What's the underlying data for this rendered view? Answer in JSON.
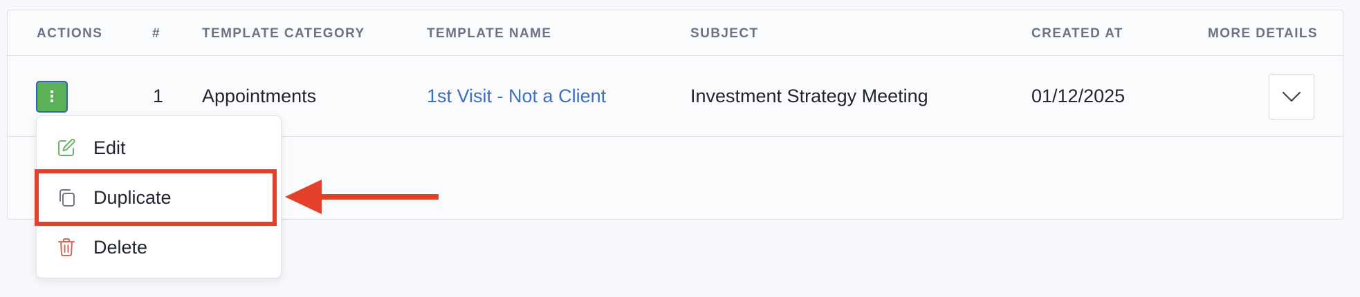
{
  "table": {
    "headers": {
      "actions": "ACTIONS",
      "number": "#",
      "template_category": "TEMPLATE CATEGORY",
      "template_name": "TEMPLATE NAME",
      "subject": "SUBJECT",
      "created_at": "CREATED AT",
      "more_details": "MORE DETAILS"
    },
    "rows": [
      {
        "number": "1",
        "template_category": "Appointments",
        "template_name": "1st Visit - Not a Client",
        "subject": "Investment Strategy Meeting",
        "created_at": "01/12/2025"
      }
    ]
  },
  "menu": {
    "items": [
      {
        "label": "Edit",
        "icon": "edit-icon"
      },
      {
        "label": "Duplicate",
        "icon": "duplicate-icon"
      },
      {
        "label": "Delete",
        "icon": "delete-icon"
      }
    ]
  },
  "annotation": {
    "highlight_color": "#e3412b",
    "highlighted_item": "Duplicate"
  },
  "colors": {
    "action_button": "#5ab157",
    "link": "#3a6fc4",
    "header_text": "#6b7285"
  }
}
